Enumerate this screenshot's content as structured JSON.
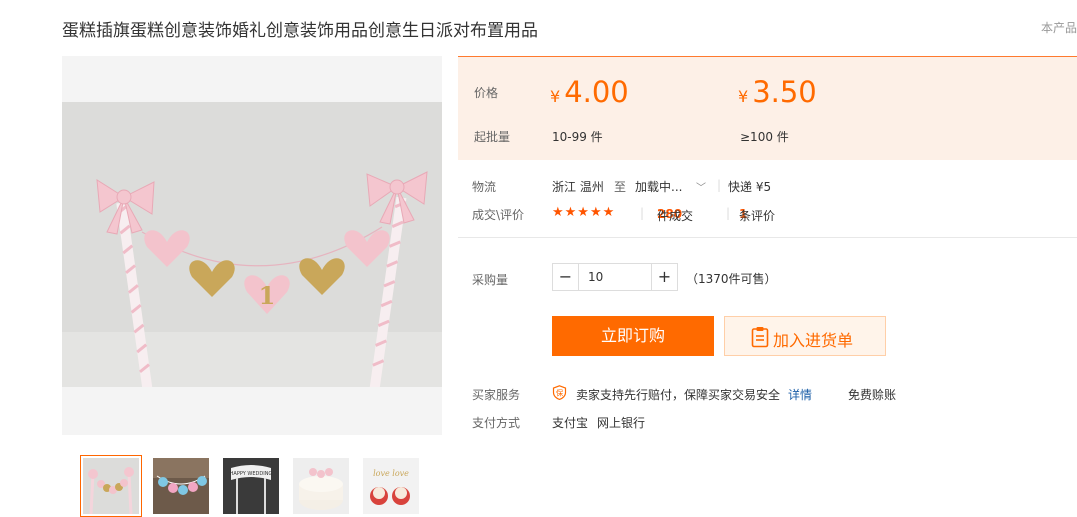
{
  "product": {
    "title": "蛋糕插旗蛋糕创意装饰婚礼创意装饰用品创意生日派对布置用品",
    "corner_note": "本产品"
  },
  "gallery": {
    "thumbnails": [
      "thumb-1",
      "thumb-2",
      "thumb-3",
      "thumb-4",
      "thumb-5"
    ],
    "active_index": 0,
    "thumb_text_3": "HAPPY WEDDING",
    "thumb_text_5": "love love"
  },
  "price": {
    "price_label": "价格",
    "moq_label": "起批量",
    "currency": "¥",
    "tiers": [
      {
        "value": "4.00",
        "range": "10-99 件"
      },
      {
        "value": "3.50",
        "range": "≥100 件"
      }
    ]
  },
  "shipping": {
    "label": "物流",
    "origin": "浙江 温州",
    "to": "至",
    "destination": "加载中...",
    "method": "快递 ¥5"
  },
  "deals": {
    "label": "成交\\评价",
    "stars": "★★★★★",
    "deal_count": "280",
    "deal_suffix": "件成交",
    "review_count": "1",
    "review_suffix": "条评价"
  },
  "purchase": {
    "qty_label": "采购量",
    "minus": "−",
    "plus": "+",
    "qty_value": "10",
    "stock_note": "（1370件可售）",
    "buy_label": "立即订购",
    "cart_label": "加入进货单"
  },
  "services": {
    "label": "买家服务",
    "guarantee_icon_text": "保",
    "guarantee": "卖家支持先行赔付，保障买家交易安全",
    "details_link": "详情",
    "free_credit": "免费赊账"
  },
  "payment": {
    "label": "支付方式",
    "methods": [
      "支付宝",
      "网上银行"
    ]
  },
  "colors": {
    "accent": "#ff6a00",
    "price_bg": "#fdf0e7",
    "link": "#1b5ea7"
  }
}
